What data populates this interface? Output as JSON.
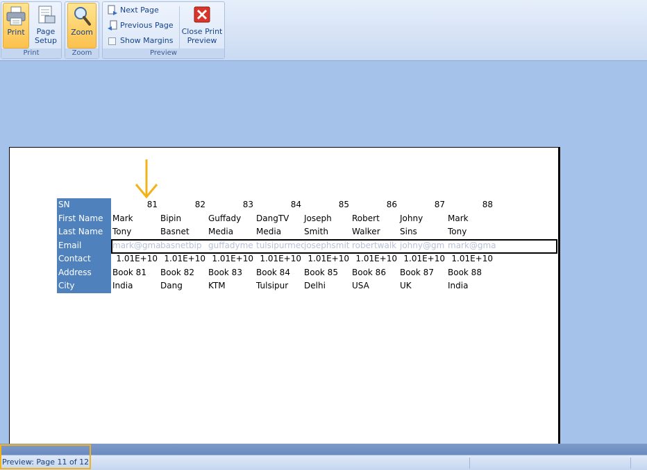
{
  "ribbon": {
    "print_group": {
      "print_label": "Print",
      "page_setup_label": "Page\nSetup",
      "group_label": "Print"
    },
    "zoom_group": {
      "zoom_label": "Zoom",
      "group_label": "Zoom"
    },
    "preview_group": {
      "next_page_label": "Next Page",
      "previous_page_label": "Previous Page",
      "show_margins_label": "Show Margins",
      "show_margins_checked": false,
      "close_preview_label": "Close Print\nPreview",
      "group_label": "Preview"
    }
  },
  "sheet": {
    "header_color": "#4f81bd",
    "rows": [
      {
        "header": "SN",
        "values": [
          "81",
          "82",
          "83",
          "84",
          "85",
          "86",
          "87",
          "88"
        ],
        "numeric": true
      },
      {
        "header": "First Name",
        "values": [
          "Mark",
          "Bipin",
          "Guffady",
          "DangTV",
          "Joseph",
          "Robert",
          "Johny",
          "Mark"
        ],
        "numeric": false
      },
      {
        "header": "Last Name",
        "values": [
          "Tony",
          "Basnet",
          "Media",
          "Media",
          "Smith",
          "Walker",
          "Sins",
          "Tony"
        ],
        "numeric": false
      },
      {
        "header": "Email",
        "values": [
          "mark@gmail",
          "basnetbip",
          "guffadyme",
          "tulsipurmedia",
          "josephsmit",
          "robertwalk",
          "johny@gm",
          "mark@gmail"
        ],
        "numeric": false,
        "faded": true
      },
      {
        "header": "Contact",
        "values": [
          "1.01E+10",
          "1.01E+10",
          "1.01E+10",
          "1.01E+10",
          "1.01E+10",
          "1.01E+10",
          "1.01E+10",
          "1.01E+10"
        ],
        "numeric": true
      },
      {
        "header": "Address",
        "values": [
          "Book 81",
          "Book 82",
          "Book 83",
          "Book 84",
          "Book 85",
          "Book 86",
          "Book 87",
          "Book 88"
        ],
        "numeric": false
      },
      {
        "header": "City",
        "values": [
          "India",
          "Dang",
          "KTM",
          "Tulsipur",
          "Delhi",
          "USA",
          "UK",
          "India"
        ],
        "numeric": false
      }
    ]
  },
  "status": {
    "text": "Preview: Page 11 of 12"
  },
  "colors": {
    "annotation": "#f2b31a",
    "ribbon_active": "#fcc14d"
  }
}
